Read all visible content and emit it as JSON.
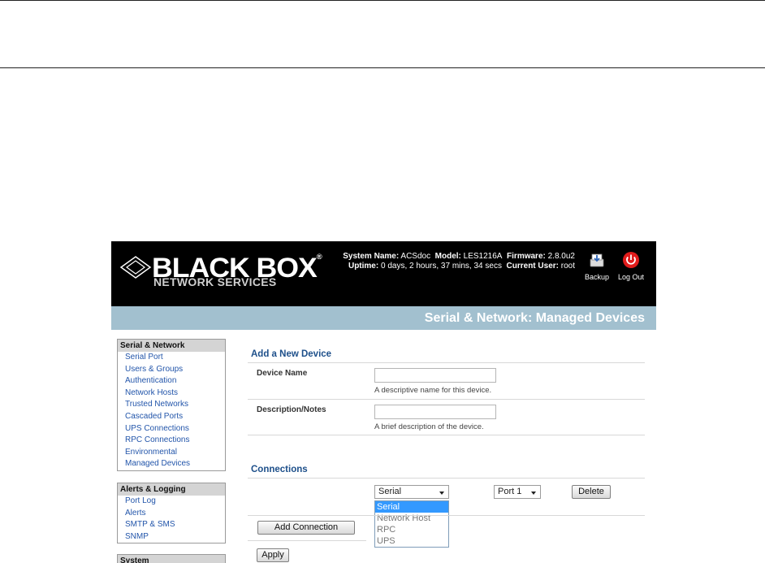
{
  "header": {
    "logo_main": "BLACK BOX",
    "logo_registered": "®",
    "logo_sub": "NETWORK SERVICES",
    "system_name_label": "System Name:",
    "system_name_value": "ACSdoc",
    "model_label": "Model:",
    "model_value": "LES1216A",
    "firmware_label": "Firmware:",
    "firmware_value": "2.8.0u2",
    "uptime_label": "Uptime:",
    "uptime_value": "0 days, 2 hours, 37 mins, 34 secs",
    "current_user_label": "Current User:",
    "current_user_value": "root",
    "backup_label": "Backup",
    "logout_label": "Log Out"
  },
  "page_title": "Serial & Network: Managed Devices",
  "sidebar": {
    "groups": [
      {
        "title": "Serial & Network",
        "items": [
          "Serial Port",
          "Users & Groups",
          "Authentication",
          "Network Hosts",
          "Trusted Networks",
          "Cascaded Ports",
          "UPS Connections",
          "RPC Connections",
          "Environmental",
          "Managed Devices"
        ]
      },
      {
        "title": "Alerts & Logging",
        "items": [
          "Port Log",
          "Alerts",
          "SMTP & SMS",
          "SNMP"
        ]
      },
      {
        "title": "System",
        "items": []
      }
    ]
  },
  "form": {
    "add_device_title": "Add a New Device",
    "device_name_label": "Device Name",
    "device_name_value": "",
    "device_name_hint": "A descriptive name for this device.",
    "description_label": "Description/Notes",
    "description_value": "",
    "description_hint": "A brief description of the device.",
    "connections_title": "Connections",
    "connection_type_selected": "Serial",
    "connection_type_options": [
      "Serial",
      "Network Host",
      "RPC",
      "UPS"
    ],
    "port_selected": "Port 1",
    "delete_label": "Delete",
    "add_connection_label": "Add Connection",
    "apply_label": "Apply"
  },
  "colors": {
    "header_bg": "#000000",
    "title_bar_bg": "#a2c0cf",
    "section_title": "#1d4f8a",
    "nav_link": "#2255aa",
    "logout_red": "#e01b1b",
    "dropdown_highlight": "#3399ff"
  }
}
